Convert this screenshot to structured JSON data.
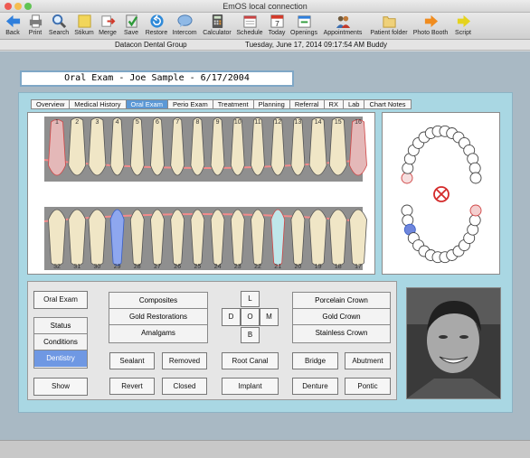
{
  "window": {
    "title": "EmOS local connection"
  },
  "toolbar": {
    "items": [
      {
        "label": "Back",
        "icon": "back-arrow-icon"
      },
      {
        "label": "Print",
        "icon": "printer-icon"
      },
      {
        "label": "Search",
        "icon": "magnifier-icon"
      },
      {
        "label": "Stikum",
        "icon": "sticky-note-icon"
      },
      {
        "label": "Merge",
        "icon": "merge-icon"
      },
      {
        "label": "Save",
        "icon": "save-icon"
      },
      {
        "label": "Restore",
        "icon": "restore-icon"
      },
      {
        "label": "Intercom",
        "icon": "speech-bubble-icon"
      },
      {
        "label": "Calculator",
        "icon": "calculator-icon"
      },
      {
        "label": "Schedule",
        "icon": "schedule-icon"
      },
      {
        "label": "Today",
        "icon": "calendar-icon"
      },
      {
        "label": "Openings",
        "icon": "openings-icon"
      },
      {
        "label": "Appointments",
        "icon": "people-icon"
      },
      {
        "label": "Patient folder",
        "icon": "folder-icon"
      },
      {
        "label": "Photo Booth",
        "icon": "arrow-right-icon"
      },
      {
        "label": "Script",
        "icon": "lightning-icon"
      }
    ],
    "calendar_day": "7"
  },
  "infobar": {
    "practice": "Datacon Dental Group",
    "datetime": "Tuesday, June 17, 2014  09:17:54 AM  Buddy"
  },
  "header": {
    "title": "Oral Exam - Joe Sample -  6/17/2004"
  },
  "tabs": [
    "Overview",
    "Medical History",
    "Oral Exam",
    "Perio Exam",
    "Treatment",
    "Planning",
    "Referral",
    "RX",
    "Lab",
    "Chart Notes"
  ],
  "active_tab": "Oral Exam",
  "chart": {
    "upper_numbers": [
      "1",
      "2",
      "3",
      "4",
      "5",
      "6",
      "7",
      "8",
      "9",
      "10",
      "11",
      "12",
      "13",
      "14",
      "15",
      "16"
    ],
    "lower_numbers": [
      "32",
      "31",
      "30",
      "29",
      "28",
      "27",
      "26",
      "25",
      "24",
      "23",
      "22",
      "21",
      "20",
      "19",
      "18",
      "17"
    ]
  },
  "controls": {
    "oral_exam": "Oral Exam",
    "status": "Status",
    "conditions": "Conditions",
    "dentistry": "Dentistry",
    "show": "Show",
    "composites": "Composites",
    "gold_restorations": "Gold Restorations",
    "amalgams": "Amalgams",
    "surface_l": "L",
    "surface_d": "D",
    "surface_o": "O",
    "surface_m": "M",
    "surface_b": "B",
    "porcelain_crown": "Porcelain Crown",
    "gold_crown": "Gold Crown",
    "stainless_crown": "Stainless Crown",
    "sealant": "Sealant",
    "removed": "Removed",
    "root_canal": "Root Canal",
    "bridge": "Bridge",
    "abutment": "Abutment",
    "revert": "Revert",
    "closed": "Closed",
    "implant": "Implant",
    "denture": "Denture",
    "pontic": "Pontic"
  }
}
